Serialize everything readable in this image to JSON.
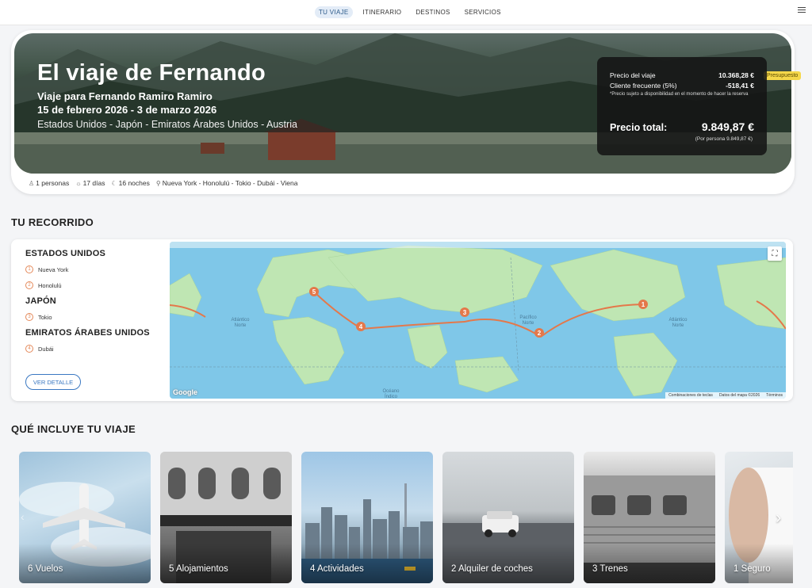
{
  "nav": {
    "tabs": [
      {
        "label": "TU VIAJE",
        "active": true
      },
      {
        "label": "ITINERARIO",
        "active": false
      },
      {
        "label": "DESTINOS",
        "active": false
      },
      {
        "label": "SERVICIOS",
        "active": false
      }
    ],
    "menu_icon": "hamburger-icon"
  },
  "hero": {
    "title": "El viaje de Fernando",
    "traveler": "Viaje para Fernando Ramiro Ramiro",
    "dates": "15 de febrero 2026 - 3 de marzo 2026",
    "countries": "Estados Unidos - Japón - Emiratos Árabes Unidos - Austria",
    "badge": "Presupuesto",
    "price": {
      "trip_label": "Precio del viaje",
      "trip_value": "10.368,28 €",
      "discount_label": "Cliente frecuente (5%)",
      "discount_value": "-518,41 €",
      "note": "*Precio sujeto a disponibilidad en el momento de hacer la reserva",
      "total_label": "Precio total:",
      "total_value": "9.849,87 €",
      "per_person": "(Por persona 9.849,87 €)"
    },
    "info": {
      "people": "1 personas",
      "days": "17 días",
      "nights": "16 noches",
      "route": "Nueva York - Honolulú - Tokio - Dubái - Viena"
    }
  },
  "route_section": {
    "title": "TU RECORRIDO",
    "countries": [
      {
        "name": "ESTADOS UNIDOS",
        "cities": [
          {
            "num": "1",
            "name": "Nueva York"
          },
          {
            "num": "2",
            "name": "Honolulú"
          }
        ]
      },
      {
        "name": "JAPÓN",
        "cities": [
          {
            "num": "3",
            "name": "Tokio"
          }
        ]
      },
      {
        "name": "EMIRATOS ÁRABES UNIDOS",
        "cities": [
          {
            "num": "4",
            "name": "Dubái"
          }
        ]
      }
    ],
    "detail_button": "VER DETALLE",
    "map": {
      "google": "Google",
      "attribution": [
        "Combinaciones de teclas",
        "Datos del mapa ©2026",
        "Términos"
      ],
      "labels": {
        "atlantic_left": "Atlántico\nNorte",
        "pacific": "Pacífico\nNorte",
        "atlantic_right": "Atlántico\nNorte",
        "indian": "Océano\nÍndico"
      },
      "markers": [
        "1",
        "2",
        "3",
        "4",
        "5"
      ]
    }
  },
  "includes_section": {
    "title": "QUÉ INCLUYE TU VIAJE",
    "cards": [
      {
        "label": "6 Vuelos"
      },
      {
        "label": "5 Alojamientos"
      },
      {
        "label": "4 Actividades"
      },
      {
        "label": "2 Alquiler de coches"
      },
      {
        "label": "3 Trenes"
      },
      {
        "label": "1 Seguro"
      }
    ]
  },
  "colors": {
    "accent": "#3a78c2",
    "route": "#e4784a",
    "badge": "#f5d74a"
  }
}
